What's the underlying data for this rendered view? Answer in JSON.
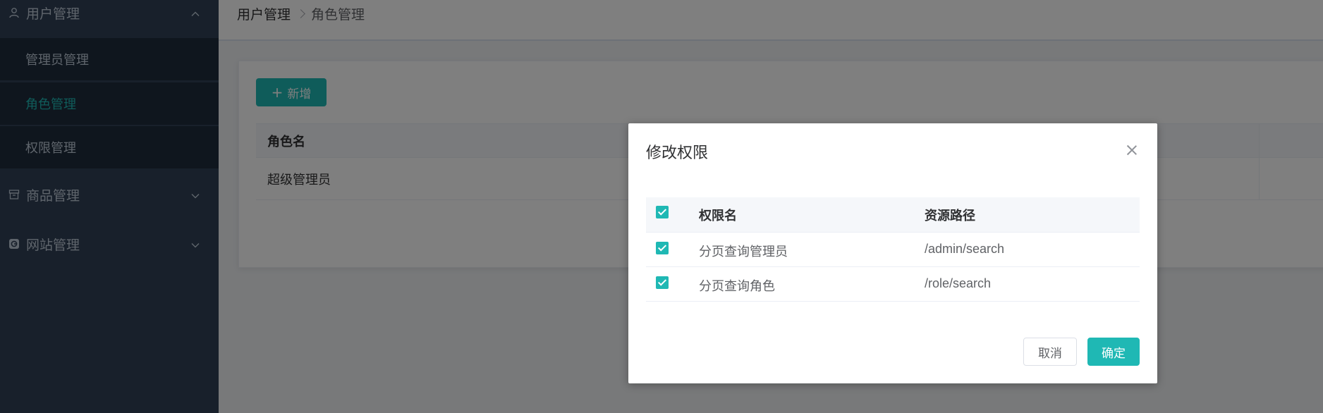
{
  "sidebar": {
    "groups": [
      {
        "label": "用户管理",
        "icon": "user-icon",
        "expanded": true
      },
      {
        "label": "商品管理",
        "icon": "box-icon",
        "expanded": false
      },
      {
        "label": "网站管理",
        "icon": "site-icon",
        "expanded": false
      }
    ],
    "sub_items": [
      {
        "label": "管理员管理",
        "active": false
      },
      {
        "label": "角色管理",
        "active": true
      },
      {
        "label": "权限管理",
        "active": false
      }
    ]
  },
  "breadcrumb": {
    "items": [
      "用户管理",
      "角色管理"
    ]
  },
  "card": {
    "add_button_label": "新增",
    "table": {
      "columns": [
        "角色名"
      ],
      "rows": [
        [
          "超级管理员"
        ]
      ]
    }
  },
  "dialog": {
    "title": "修改权限",
    "table": {
      "columns": [
        "权限名",
        "资源路径"
      ],
      "header_checked": true,
      "rows": [
        {
          "name": "分页查询管理员",
          "path": "/admin/search",
          "checked": true
        },
        {
          "name": "分页查询角色",
          "path": "/role/search",
          "checked": true
        }
      ]
    },
    "cancel_label": "取消",
    "confirm_label": "确定"
  },
  "colors": {
    "accent": "#1fb8b4",
    "sidebar_bg": "#304156",
    "submenu_bg": "#1f2d3d",
    "overlay": "rgba(0,0,0,0.5)"
  }
}
